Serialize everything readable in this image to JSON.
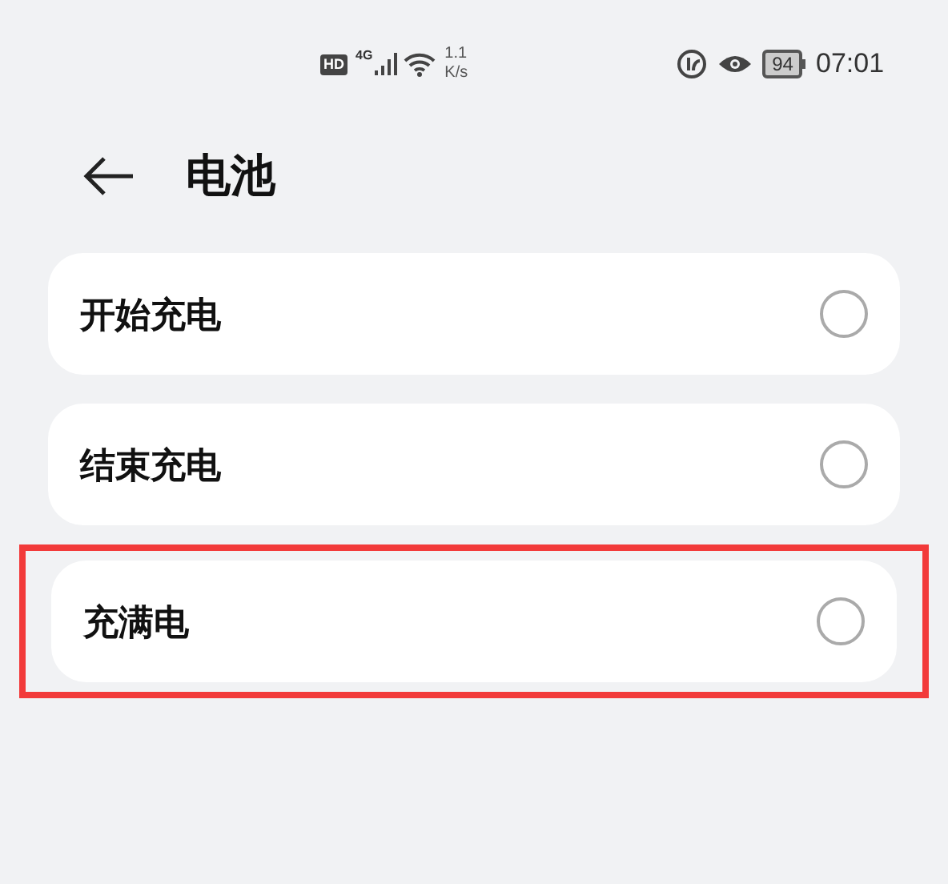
{
  "status_bar": {
    "hd": "HD",
    "network": "4G",
    "speed_value": "1.1",
    "speed_unit": "K/s",
    "battery": "94",
    "time": "07:01"
  },
  "header": {
    "title": "电池"
  },
  "options": [
    {
      "label": "开始充电",
      "selected": false,
      "highlighted": false
    },
    {
      "label": "结束充电",
      "selected": false,
      "highlighted": false
    },
    {
      "label": "充满电",
      "selected": false,
      "highlighted": true
    }
  ]
}
